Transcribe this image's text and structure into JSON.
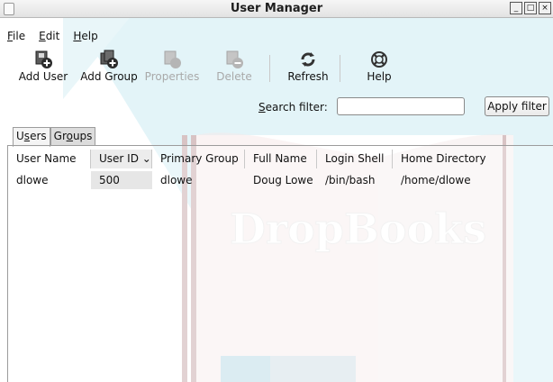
{
  "window": {
    "title": "User Manager",
    "controls": [
      "_",
      "□",
      "×"
    ]
  },
  "menu": [
    {
      "pre": "",
      "u": "F",
      "post": "ile"
    },
    {
      "pre": "",
      "u": "E",
      "post": "dit"
    },
    {
      "pre": "",
      "u": "H",
      "post": "elp"
    }
  ],
  "toolbar": [
    {
      "label": "Add User",
      "icon": "add-user-icon",
      "enabled": true
    },
    {
      "label": "Add Group",
      "icon": "add-group-icon",
      "enabled": true
    },
    {
      "label": "Properties",
      "icon": "properties-icon",
      "enabled": false
    },
    {
      "label": "Delete",
      "icon": "delete-icon",
      "enabled": false
    },
    {
      "label": "Refresh",
      "icon": "refresh-icon",
      "enabled": true
    },
    {
      "label": "Help",
      "icon": "help-lifebuoy-icon",
      "enabled": true
    }
  ],
  "filter": {
    "label_u": "S",
    "label_rest": "earch filter:",
    "value": "",
    "apply_label": "Apply filter"
  },
  "tabs": [
    {
      "pre": "U",
      "u": "s",
      "post": "ers",
      "active": true
    },
    {
      "pre": "Gr",
      "u": "o",
      "post": "ups",
      "active": false
    }
  ],
  "columns": [
    "User Name",
    "User ID ⌄",
    "Primary Group",
    "Full Name",
    "Login Shell",
    "Home Directory"
  ],
  "rows": [
    [
      "dlowe",
      "500",
      "dlowe",
      "Doug Lowe",
      "/bin/bash",
      "/home/dlowe"
    ]
  ],
  "watermark": {
    "text": "DropBooks"
  }
}
